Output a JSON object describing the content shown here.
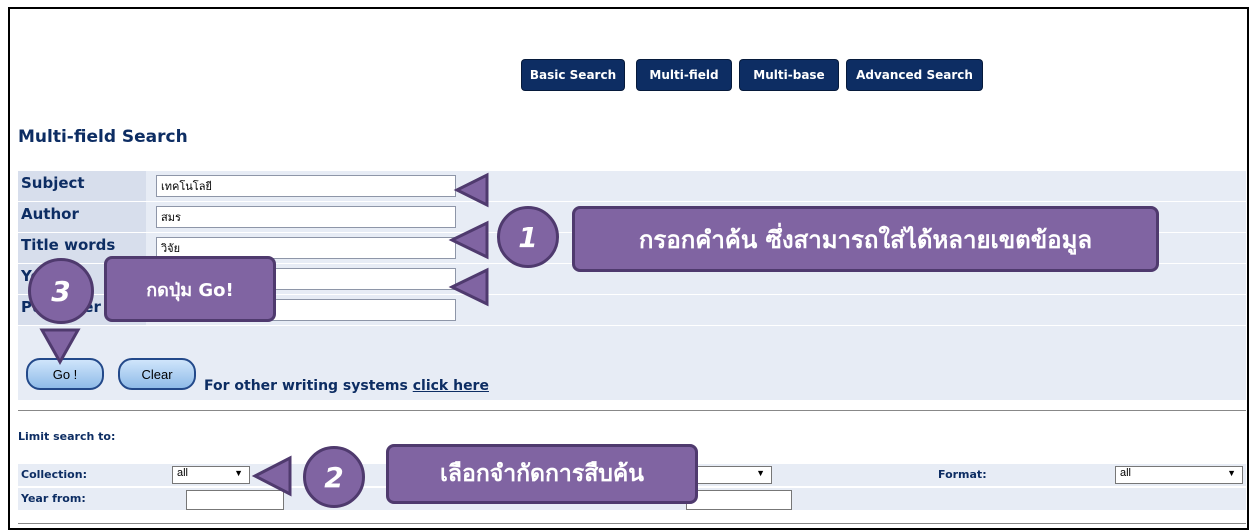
{
  "nav": {
    "basic_search": "Basic Search",
    "multi_field": "Multi-field",
    "multi_base": "Multi-base",
    "advanced_search": "Advanced Search"
  },
  "page_title": "Multi-field Search",
  "fields": [
    {
      "label": "Subject",
      "value": "เทคโนโลยี"
    },
    {
      "label": "Author",
      "value": "สมร"
    },
    {
      "label": "Title words",
      "value": "วิจัย"
    },
    {
      "label": "Year",
      "value": ""
    },
    {
      "label": "Publisher",
      "value": ""
    }
  ],
  "actions": {
    "go_label": "Go !",
    "clear_label": "Clear",
    "other_text": "For other writing systems ",
    "other_link": "click here"
  },
  "limit": {
    "title": "Limit search to:",
    "collection_label": "Collection:",
    "collection_value": "all",
    "format_label": "Format:",
    "format_value": "all",
    "year_from_label": "Year from:"
  },
  "annotations": {
    "step1_num": "1",
    "step1_text": "กรอกคำค้น  ซึ่งสามารถใส่ได้หลายเขตข้อมูล",
    "step2_num": "2",
    "step2_text": "เลือกจำกัดการสืบค้น",
    "step3_num": "3",
    "step3_text": "กดปุ่ม Go!"
  },
  "colors": {
    "nav_bg": "#0d2d63",
    "label_text": "#0d2d63",
    "annotation_fill": "#8064a2",
    "annotation_border": "#4f3a6e"
  }
}
